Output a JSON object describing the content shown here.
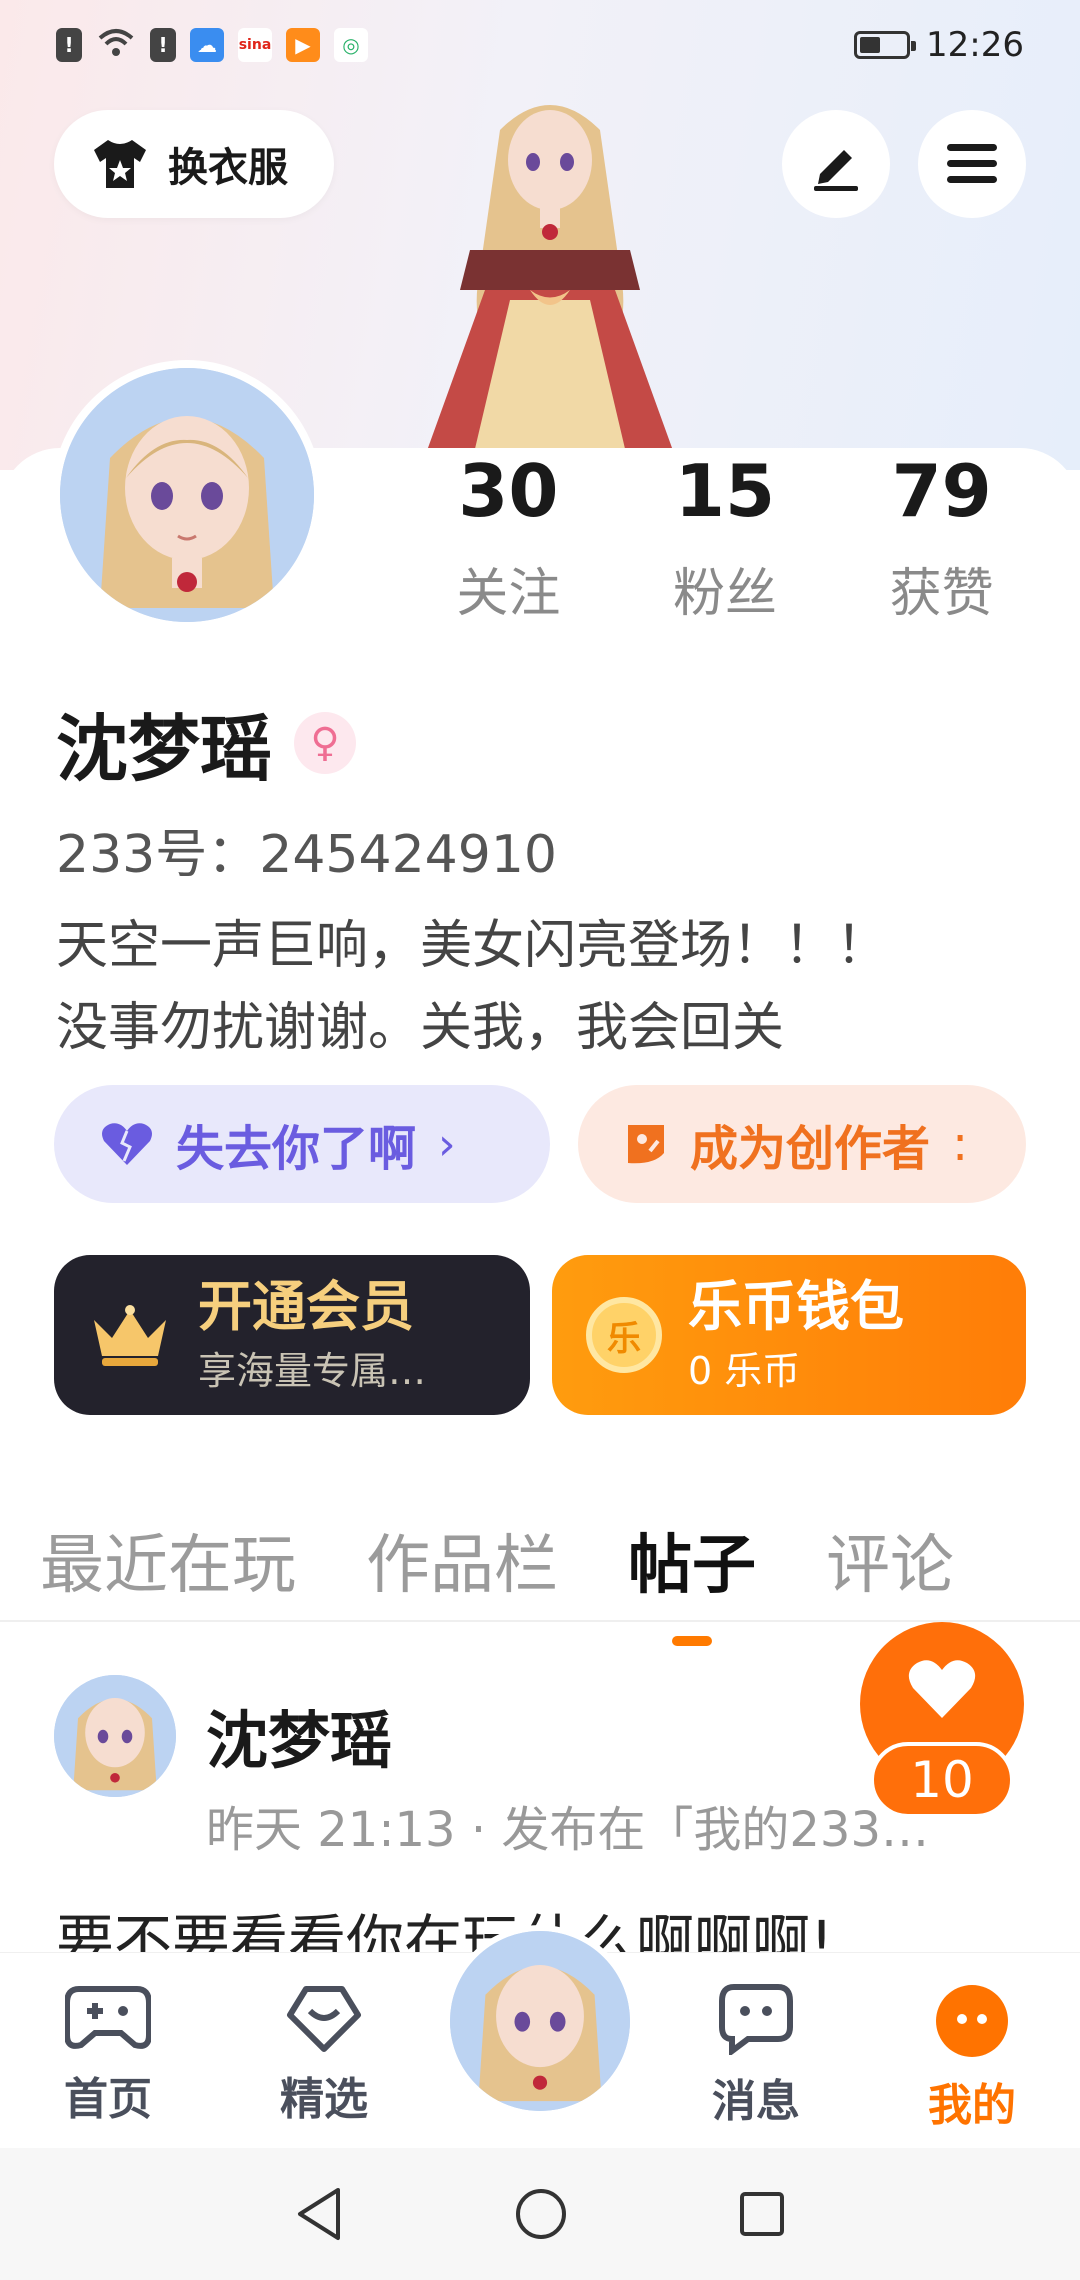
{
  "status_bar": {
    "time": "12:26"
  },
  "header": {
    "dress_label": "换衣服"
  },
  "profile": {
    "name": "沈梦瑶",
    "gender_symbol": "♀",
    "uid": "233号：245424910",
    "bio_line1": "天空一声巨响，美女闪亮登场！！！",
    "bio_line2": "没事勿扰谢谢。关我，我会回关"
  },
  "stats": [
    {
      "value": "30",
      "label": "关注"
    },
    {
      "value": "15",
      "label": "粉丝"
    },
    {
      "value": "79",
      "label": "获赞"
    }
  ],
  "tags": {
    "purple_label": "失去你了啊",
    "orange_label": "成为创作者"
  },
  "promos": {
    "vip_title": "开通会员",
    "vip_sub": "享海量专属…",
    "wallet_title": "乐币钱包",
    "wallet_sub": "0 乐币",
    "wallet_coin": "乐"
  },
  "tabs": [
    "最近在玩",
    "作品栏",
    "帖子",
    "评论"
  ],
  "post": {
    "author": "沈梦瑶",
    "meta": "昨天 21:13 · 发布在「我的233…",
    "body": "要不要看看你在玩什么啊啊啊!"
  },
  "like_count": "10",
  "bottom_nav": [
    {
      "label": "首页",
      "icon": "gamepad-icon"
    },
    {
      "label": "精选",
      "icon": "heart-diamond-icon"
    },
    {
      "label": "消息",
      "icon": "chat-icon"
    },
    {
      "label": "我的",
      "icon": "profile-dots-icon"
    }
  ],
  "colors": {
    "accent": "#ff7300",
    "purple": "#6a5ce0",
    "vip_bg": "#23222c",
    "wallet_bg": "#ff8a0a"
  }
}
